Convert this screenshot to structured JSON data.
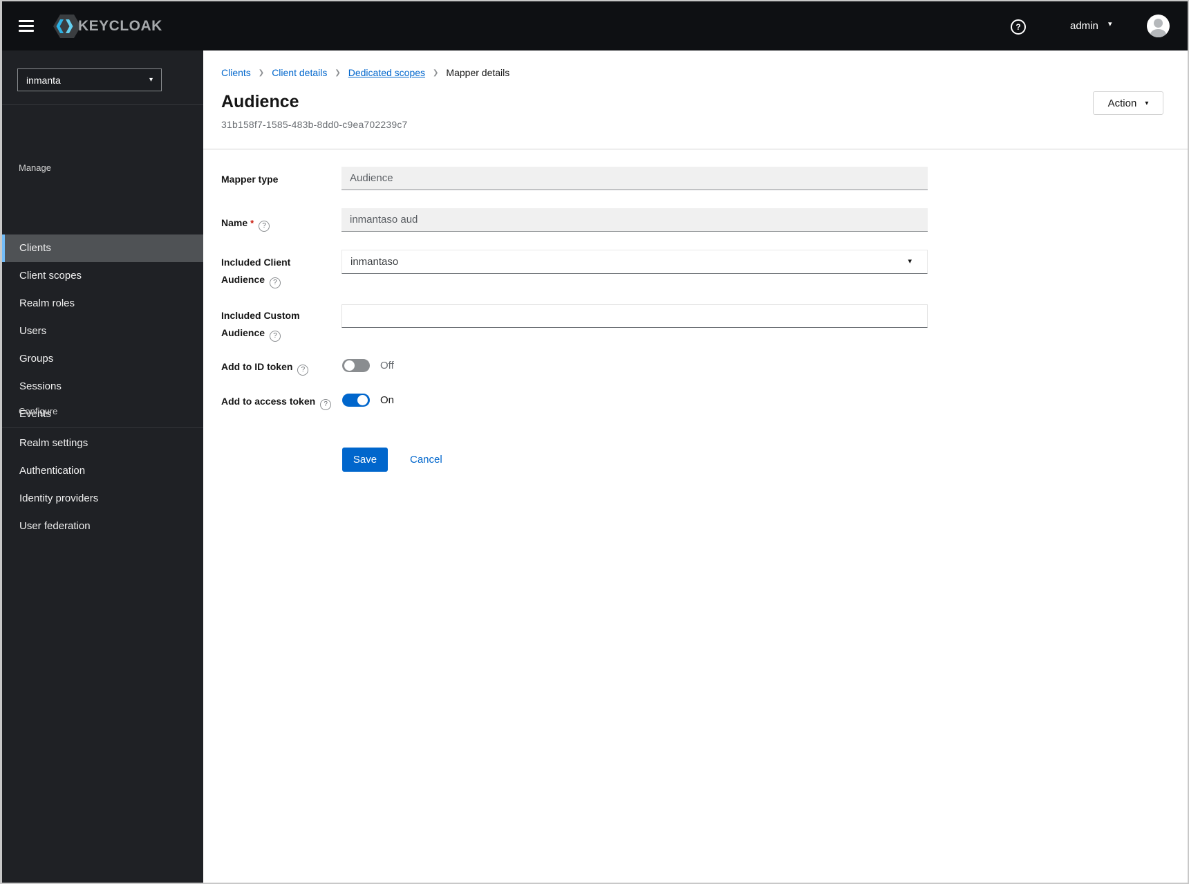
{
  "colors": {
    "primary_blue": "#0066cc",
    "link_blue": "#0066cc",
    "nav_active_accent": "#73bcf7",
    "toggle_off_gray": "#8a8d90",
    "header_bg": "#0e1013",
    "sidebar_bg": "#1f2125",
    "logo_cyan": "#2db3e6"
  },
  "icons": {
    "question": "?",
    "caret_down": "▾",
    "breadcrumb_separator": "❯"
  },
  "header": {
    "brand": "KEYCLOAK",
    "username": "admin"
  },
  "sidebar": {
    "realm": "inmanta",
    "sections": [
      {
        "title": "Manage",
        "items": [
          {
            "label": "Clients",
            "active": true
          },
          {
            "label": "Client scopes",
            "active": false
          },
          {
            "label": "Realm roles",
            "active": false
          },
          {
            "label": "Users",
            "active": false
          },
          {
            "label": "Groups",
            "active": false
          },
          {
            "label": "Sessions",
            "active": false
          },
          {
            "label": "Events",
            "active": false
          }
        ]
      },
      {
        "title": "Configure",
        "items": [
          {
            "label": "Realm settings",
            "active": false
          },
          {
            "label": "Authentication",
            "active": false
          },
          {
            "label": "Identity providers",
            "active": false
          },
          {
            "label": "User federation",
            "active": false
          }
        ]
      }
    ]
  },
  "breadcrumb": [
    {
      "label": "Clients",
      "link": true
    },
    {
      "label": "Client details",
      "link": true
    },
    {
      "label": "Dedicated scopes",
      "link": true
    },
    {
      "label": "Mapper details",
      "link": false
    }
  ],
  "page": {
    "title": "Audience",
    "subtitle": "31b158f7-1585-483b-8dd0-c9ea702239c7",
    "action_button": "Action"
  },
  "form": {
    "mapper_type": {
      "label": "Mapper type",
      "value": "Audience"
    },
    "name": {
      "label": "Name",
      "required_marker": "*",
      "value": "inmantaso aud"
    },
    "included_client_audience": {
      "label": "Included Client Audience",
      "value": "inmantaso"
    },
    "included_custom_audience": {
      "label": "Included Custom Audience",
      "value": ""
    },
    "add_to_id_token": {
      "label": "Add to ID token",
      "state": "Off"
    },
    "add_to_access_token": {
      "label": "Add to access token",
      "state": "On"
    },
    "save": "Save",
    "cancel": "Cancel"
  }
}
